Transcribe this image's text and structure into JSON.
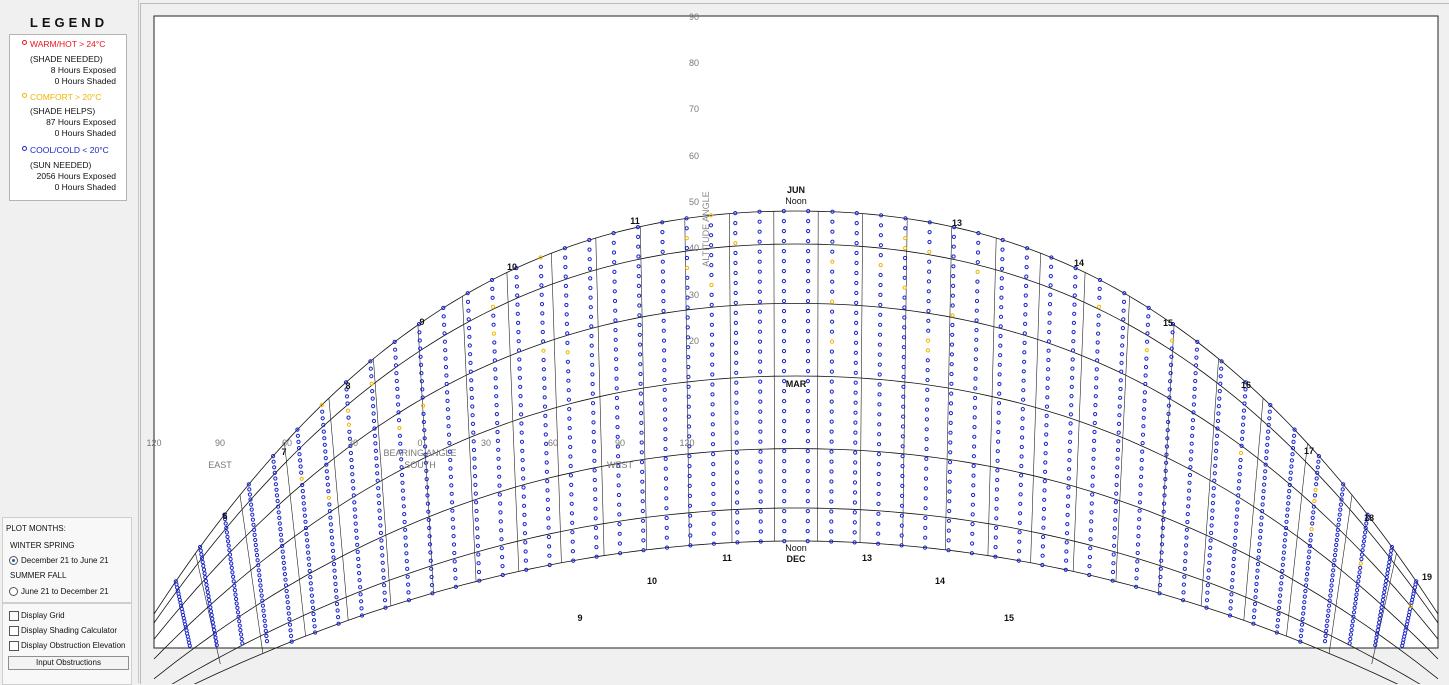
{
  "legend": {
    "title": "LEGEND",
    "entries": [
      {
        "label": "WARM/HOT  > 24°C",
        "color": "#e8141e",
        "sub": "(SHADE NEEDED)",
        "exposed": "8 Hours Exposed",
        "shaded": "0 Hours Shaded"
      },
      {
        "label": "COMFORT  > 20°C",
        "color": "#f0b400",
        "sub": "(SHADE HELPS)",
        "exposed": "87 Hours Exposed",
        "shaded": "0 Hours Shaded"
      },
      {
        "label": "COOL/COLD  < 20°C",
        "color": "#1a25c8",
        "sub": "(SUN NEEDED)",
        "exposed": "2056 Hours Exposed",
        "shaded": "0 Hours Shaded"
      }
    ]
  },
  "plot_months": {
    "title": "PLOT MONTHS:",
    "winter_spring_label": "WINTER SPRING",
    "winter_spring_option": "December 21 to June 21",
    "summer_fall_label": "SUMMER FALL",
    "summer_fall_option": "June 21 to December 21",
    "selected": "winter_spring"
  },
  "options": {
    "display_grid": "Display Grid",
    "display_shading": "Display Shading Calculator",
    "display_obstruction": "Display Obstruction Elevation",
    "input_obstructions": "Input Obstructions"
  },
  "chart_data": {
    "type": "scatter",
    "altitude_ticks": [
      20,
      30,
      40,
      50,
      60,
      70,
      80,
      90
    ],
    "altitude_label": "ALTITUDE ANGLE",
    "bearing_ticks": [
      120,
      90,
      60,
      30,
      0,
      30,
      60,
      90,
      120
    ],
    "bearing_label": "BEARING ANGLE",
    "directions": [
      "EAST",
      "SOUTH",
      "WEST"
    ],
    "month_labels": {
      "jun": "JUN",
      "mar": "MAR",
      "dec": "DEC",
      "noon": "Noon"
    },
    "hour_labels_upper": [
      6,
      7,
      8,
      9,
      10,
      11,
      13,
      14,
      15,
      16,
      17,
      18,
      19
    ],
    "hour_labels_lower": [
      9,
      10,
      11,
      13,
      14,
      15
    ],
    "colors": {
      "cold": "#1a25c8",
      "comfort": "#f0b400",
      "hot": "#e8141e"
    }
  }
}
